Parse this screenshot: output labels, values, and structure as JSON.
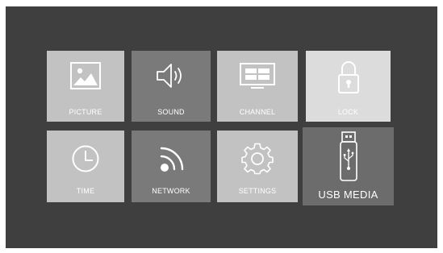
{
  "menu": {
    "tiles": [
      {
        "id": "picture",
        "label": "PICTURE",
        "icon": "picture-icon",
        "color": "#c2c2c2",
        "selected": false
      },
      {
        "id": "sound",
        "label": "SOUND",
        "icon": "speaker-icon",
        "color": "#7a7a7a",
        "selected": false
      },
      {
        "id": "channel",
        "label": "CHANNEL",
        "icon": "monitor-icon",
        "color": "#c2c2c2",
        "selected": false
      },
      {
        "id": "lock",
        "label": "LOCK",
        "icon": "padlock-icon",
        "color": "#dcdcdc",
        "selected": false
      },
      {
        "id": "time",
        "label": "TIME",
        "icon": "clock-icon",
        "color": "#c2c2c2",
        "selected": false
      },
      {
        "id": "network",
        "label": "NETWORK",
        "icon": "wifi-icon",
        "color": "#7a7a7a",
        "selected": false
      },
      {
        "id": "settings",
        "label": "SETTINGS",
        "icon": "gear-icon",
        "color": "#c2c2c2",
        "selected": false
      },
      {
        "id": "usb",
        "label": "USB MEDIA",
        "icon": "usb-drive-icon",
        "color": "#6c6c6c",
        "selected": true
      }
    ]
  }
}
